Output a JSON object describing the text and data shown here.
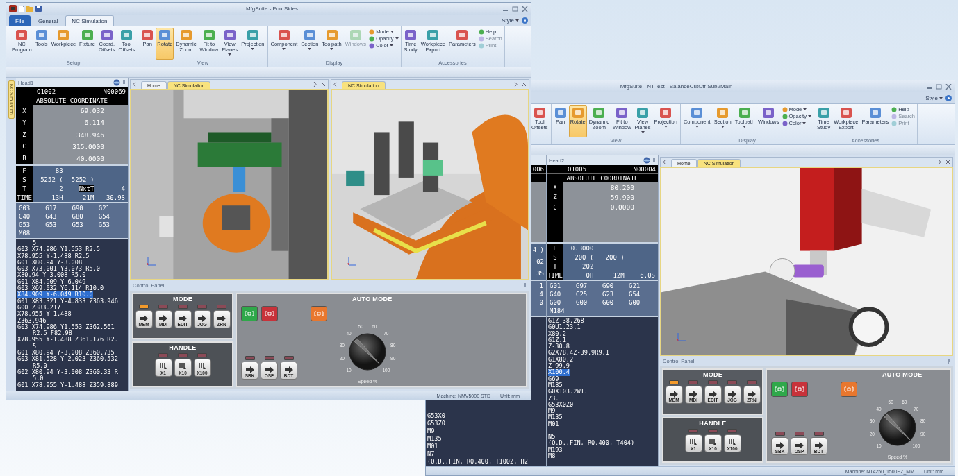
{
  "windows": [
    {
      "title": "MfgSuite - FourSides",
      "tabs": [
        {
          "label": "File",
          "kind": "app",
          "selected": false
        },
        {
          "label": "General",
          "kind": "tab",
          "selected": false
        },
        {
          "label": "NC Simulation",
          "kind": "tab",
          "selected": true
        }
      ],
      "style_menu": "Style",
      "ribbon": [
        {
          "label": "Setup",
          "buttons": [
            {
              "label": "NC\nProgram",
              "selected": false,
              "disabled": false,
              "dropdown": false
            },
            {
              "label": "Tools",
              "selected": false,
              "disabled": false,
              "dropdown": false
            },
            {
              "label": "Workpiece",
              "selected": false,
              "disabled": false,
              "dropdown": false
            },
            {
              "label": "Fixture",
              "selected": false,
              "disabled": false,
              "dropdown": false
            },
            {
              "label": "Coord.\nOffsets",
              "selected": false,
              "disabled": false,
              "dropdown": false
            },
            {
              "label": "Tool\nOffsets",
              "selected": false,
              "disabled": false,
              "dropdown": false
            }
          ]
        },
        {
          "label": "View",
          "buttons": [
            {
              "label": "Pan",
              "selected": false,
              "disabled": false,
              "dropdown": false
            },
            {
              "label": "Rotate",
              "selected": true,
              "disabled": false,
              "dropdown": false
            },
            {
              "label": "Dynamic\nZoom",
              "selected": false,
              "disabled": false,
              "dropdown": false
            },
            {
              "label": "Fit to\nWindow",
              "selected": false,
              "disabled": false,
              "dropdown": false
            },
            {
              "label": "View\nPlanes",
              "selected": false,
              "disabled": false,
              "dropdown": true
            },
            {
              "label": "Projection",
              "selected": false,
              "disabled": false,
              "dropdown": true
            }
          ]
        },
        {
          "label": "Display",
          "buttons": [
            {
              "label": "Component",
              "selected": false,
              "disabled": false,
              "dropdown": true
            },
            {
              "label": "Section",
              "selected": false,
              "disabled": false,
              "dropdown": true
            },
            {
              "label": "Toolpath",
              "selected": false,
              "disabled": false,
              "dropdown": true
            },
            {
              "label": "Windows",
              "selected": false,
              "disabled": true,
              "dropdown": false
            }
          ],
          "small_buttons": [
            {
              "label": "Mode",
              "disabled": false,
              "dropdown": true
            },
            {
              "label": "Opacity",
              "disabled": false,
              "dropdown": true
            },
            {
              "label": "Color",
              "disabled": false,
              "dropdown": true
            }
          ]
        },
        {
          "label": "Accessories",
          "buttons": [
            {
              "label": "Time\nStudy",
              "selected": false,
              "disabled": false,
              "dropdown": false
            },
            {
              "label": "Workpiece\nExport",
              "selected": false,
              "disabled": false,
              "dropdown": false
            },
            {
              "label": "Parameters",
              "selected": false,
              "disabled": false,
              "dropdown": false
            }
          ],
          "small_buttons": [
            {
              "label": "Help",
              "disabled": false,
              "dropdown": false
            },
            {
              "label": "Search",
              "disabled": true,
              "dropdown": false
            },
            {
              "label": "Print",
              "disabled": true,
              "dropdown": false
            }
          ]
        }
      ],
      "side_tab": "NC Simulation",
      "nc_panel": {
        "title": "Head1",
        "program": "O1002",
        "sequence": "N00069",
        "heading": "ABSOLUTE COORDINATE",
        "axes": [
          {
            "label": "X",
            "value": "69.032"
          },
          {
            "label": "Y",
            "value": "6.114"
          },
          {
            "label": "Z",
            "value": "348.946"
          },
          {
            "label": "C",
            "value": "315.0000"
          },
          {
            "label": "B",
            "value": "40.0000"
          }
        ],
        "status_rows": [
          {
            "label": "F",
            "cells": [
              {
                "text": "83",
                "boxed": false
              }
            ]
          },
          {
            "label": "S",
            "cells": [
              {
                "text": "5252 (",
                "boxed": false
              },
              {
                "text": "5252 )",
                "boxed": false
              }
            ]
          },
          {
            "label": "T",
            "cells": [
              {
                "text": "2",
                "boxed": false
              },
              {
                "text": "NxtT",
                "boxed": true
              },
              {
                "text": "4",
                "boxed": false
              }
            ]
          },
          {
            "label": "TIME",
            "cells": [
              {
                "text": "13H",
                "boxed": false
              },
              {
                "text": "21M",
                "boxed": false
              },
              {
                "text": "30.9S",
                "boxed": false
              }
            ]
          }
        ],
        "modal_codes": [
          "G03",
          "G17",
          "G90",
          "G21",
          "G40",
          "G43",
          "G80",
          "G54",
          "G53",
          "G53",
          "G53",
          "G53",
          "M08"
        ],
        "code_lines": [
          {
            "text": "5",
            "continued": true,
            "selected": false
          },
          {
            "text": "G03 X74.986 Y1.553 R2.5",
            "continued": false,
            "selected": false
          },
          {
            "text": "X78.955 Y-1.488 R2.5",
            "continued": false,
            "selected": false
          },
          {
            "text": "G01 X80.94 Y-3.008",
            "continued": false,
            "selected": false
          },
          {
            "text": "G03 X73.001 Y3.073 R5.0",
            "continued": false,
            "selected": false
          },
          {
            "text": "X80.94 Y-3.008 R5.0",
            "continued": false,
            "selected": false
          },
          {
            "text": "G01 X84.909 Y-6.049",
            "continued": false,
            "selected": false
          },
          {
            "text": "G03 X69.032 Y6.114 R10.0",
            "continued": false,
            "selected": false
          },
          {
            "text": "X84.909 Y-6.049 R10.0",
            "continued": false,
            "selected": true
          },
          {
            "text": "G01 X83.321 Y-4.833 Z363.946",
            "continued": false,
            "selected": false
          },
          {
            "text": "G00 Z383.217",
            "continued": false,
            "selected": false
          },
          {
            "text": "X78.955 Y-1.488",
            "continued": false,
            "selected": false
          },
          {
            "text": "Z363.946",
            "continued": false,
            "selected": false
          },
          {
            "text": "G03 X74.986 Y1.553 Z362.561",
            "continued": false,
            "selected": false
          },
          {
            "text": "R2.5 F82.98",
            "continued": true,
            "selected": false
          },
          {
            "text": "X78.955 Y-1.488 Z361.176 R2.",
            "continued": false,
            "selected": false
          },
          {
            "text": "5",
            "continued": true,
            "selected": false
          },
          {
            "text": "G01 X80.94 Y-3.008 Z360.735",
            "continued": false,
            "selected": false
          },
          {
            "text": "G03 X81.528 Y-2.023 Z360.532",
            "continued": false,
            "selected": false
          },
          {
            "text": "R5.0",
            "continued": true,
            "selected": false
          },
          {
            "text": "G02 X80.94 Y-3.008 Z360.33 R",
            "continued": false,
            "selected": false
          },
          {
            "text": "5.0",
            "continued": true,
            "selected": false
          },
          {
            "text": "G01 X78.955 Y-1.488 Z359.889",
            "continued": false,
            "selected": false
          }
        ]
      },
      "panes": [
        {
          "kind": "top_view",
          "tabs": [
            {
              "label": "Home",
              "selected": false
            },
            {
              "label": "NC Simulation",
              "selected": true
            }
          ]
        },
        {
          "kind": "spindle_view",
          "tabs": [
            {
              "label": "NC Simulation",
              "selected": true
            }
          ]
        }
      ],
      "control_panel": {
        "title": "Control Panel",
        "mode": {
          "title": "MODE",
          "buttons": [
            {
              "label": "MEM",
              "lit": true
            },
            {
              "label": "MDI",
              "lit": false
            },
            {
              "label": "EDIT",
              "lit": false
            },
            {
              "label": "JOG",
              "lit": false
            },
            {
              "label": "ZRN",
              "lit": false
            }
          ]
        },
        "handle": {
          "title": "HANDLE",
          "buttons": [
            {
              "label": "X1",
              "lit": false
            },
            {
              "label": "X10",
              "lit": false
            },
            {
              "label": "X100",
              "lit": false
            }
          ]
        },
        "auto": {
          "title": "AUTO MODE",
          "cycle_buttons": [
            {
              "color": "#2fa84a"
            },
            {
              "color": "#c8323a"
            },
            {
              "color": "#e8772e"
            }
          ],
          "buttons": [
            {
              "label": "SBK",
              "lit": false
            },
            {
              "label": "OSP",
              "lit": false
            },
            {
              "label": "BDT",
              "lit": false
            }
          ],
          "dial": {
            "label": "Speed %",
            "ticks": [
              "10",
              "20",
              "30",
              "40",
              "50",
              "60",
              "70",
              "80",
              "90",
              "100"
            ]
          }
        }
      },
      "status": {
        "machine": "Machine: NMV5000 STD",
        "unit": "Unit: mm"
      }
    },
    {
      "title": "MfgSuite - NTTest - BalanceCutOff-Sub2Main",
      "style_menu": "Style",
      "ribbon": [
        {
          "buttons": [
            {
              "label": "Tool\nOffsets",
              "selected": false,
              "disabled": false,
              "dropdown": false
            }
          ]
        },
        {
          "label": "View",
          "buttons": [
            {
              "label": "Pan",
              "selected": false,
              "disabled": false,
              "dropdown": false
            },
            {
              "label": "Rotate",
              "selected": true,
              "disabled": false,
              "dropdown": false
            },
            {
              "label": "Dynamic\nZoom",
              "selected": false,
              "disabled": false,
              "dropdown": false
            },
            {
              "label": "Fit to\nWindow",
              "selected": false,
              "disabled": false,
              "dropdown": false
            },
            {
              "label": "View\nPlanes",
              "selected": false,
              "disabled": false,
              "dropdown": true
            },
            {
              "label": "Projection",
              "selected": false,
              "disabled": false,
              "dropdown": true
            }
          ]
        },
        {
          "label": "Display",
          "buttons": [
            {
              "label": "Component",
              "selected": false,
              "disabled": false,
              "dropdown": true
            },
            {
              "label": "Section",
              "selected": false,
              "disabled": false,
              "dropdown": true
            },
            {
              "label": "Toolpath",
              "selected": false,
              "disabled": false,
              "dropdown": true
            },
            {
              "label": "Windows",
              "selected": false,
              "disabled": false,
              "dropdown": false
            }
          ],
          "small_buttons": [
            {
              "label": "Mode",
              "disabled": false,
              "dropdown": true
            },
            {
              "label": "Opacity",
              "disabled": false,
              "dropdown": true
            },
            {
              "label": "Color",
              "disabled": false,
              "dropdown": true
            }
          ]
        },
        {
          "label": "Accessories",
          "buttons": [
            {
              "label": "Time\nStudy",
              "selected": false,
              "disabled": false,
              "dropdown": false
            },
            {
              "label": "Workpiece\nExport",
              "selected": false,
              "disabled": false,
              "dropdown": false
            },
            {
              "label": "Parameters",
              "selected": false,
              "disabled": false,
              "dropdown": false
            }
          ],
          "small_buttons": [
            {
              "label": "Help",
              "disabled": false,
              "dropdown": false
            },
            {
              "label": "Search",
              "disabled": true,
              "dropdown": false
            },
            {
              "label": "Print",
              "disabled": true,
              "dropdown": false
            }
          ]
        }
      ],
      "partial_panel": {
        "program_tail": "006",
        "status_tails": [
          "4 )",
          "02",
          "3S"
        ],
        "modal_tails": [
          "1",
          "4",
          "0"
        ],
        "code_lines": [
          "G53X0",
          "G53Z0",
          "M9",
          "M135",
          "M01",
          "N7",
          "(O.D.,FIN, R0.400, T1002, H2"
        ]
      },
      "nc_panel": {
        "title": "Head2",
        "program": "O1005",
        "sequence": "N00004",
        "heading": "ABSOLUTE COORDINATE",
        "axes": [
          {
            "label": "X",
            "value": "80.200"
          },
          {
            "label": "Z",
            "value": "-59.900"
          },
          {
            "label": "C",
            "value": "0.0000"
          }
        ],
        "status_rows": [
          {
            "label": "F",
            "cells": [
              {
                "text": "0.3000",
                "boxed": false
              }
            ]
          },
          {
            "label": "S",
            "cells": [
              {
                "text": "200 (",
                "boxed": false
              },
              {
                "text": "200 )",
                "boxed": false
              }
            ]
          },
          {
            "label": "T",
            "cells": [
              {
                "text": "202",
                "boxed": false
              }
            ]
          },
          {
            "label": "TIME",
            "cells": [
              {
                "text": "0H",
                "boxed": false
              },
              {
                "text": "12M",
                "boxed": false
              },
              {
                "text": "6.0S",
                "boxed": false
              }
            ]
          }
        ],
        "modal_codes": [
          "G01",
          "G97",
          "G90",
          "G21",
          "G40",
          "G25",
          "G23",
          "G54",
          "G00",
          "G00",
          "G00",
          "G00",
          "M184"
        ],
        "code_lines": [
          {
            "text": "G1Z-38.268",
            "continued": false,
            "selected": false
          },
          {
            "text": "G0U1.23.1",
            "continued": false,
            "selected": false
          },
          {
            "text": "X80.2",
            "continued": false,
            "selected": false
          },
          {
            "text": "G1Z.1",
            "continued": false,
            "selected": false
          },
          {
            "text": "Z-30.8",
            "continued": false,
            "selected": false
          },
          {
            "text": "G2X78.4Z-39.9R9.1",
            "continued": false,
            "selected": false
          },
          {
            "text": "G1X80.2",
            "continued": false,
            "selected": false
          },
          {
            "text": "Z-99.9",
            "continued": false,
            "selected": false
          },
          {
            "text": "X100.4",
            "continued": false,
            "selected": true
          },
          {
            "text": "G69",
            "continued": false,
            "selected": false
          },
          {
            "text": "M185",
            "continued": false,
            "selected": false
          },
          {
            "text": "G0X103.2W1.",
            "continued": false,
            "selected": false
          },
          {
            "text": "Z3.",
            "continued": false,
            "selected": false
          },
          {
            "text": "G53X0Z0",
            "continued": false,
            "selected": false
          },
          {
            "text": "M9",
            "continued": false,
            "selected": false
          },
          {
            "text": "M135",
            "continued": false,
            "selected": false
          },
          {
            "text": "M01",
            "continued": false,
            "selected": false
          },
          {
            "text": "N5",
            "continued": false,
            "selected": false,
            "blank_before": true
          },
          {
            "text": "(O.D.,FIN, R0.400, T404)",
            "continued": false,
            "selected": false
          },
          {
            "text": "M193",
            "continued": false,
            "selected": false
          },
          {
            "text": "M8",
            "continued": false,
            "selected": false
          }
        ]
      },
      "panes": [
        {
          "kind": "turret_view",
          "tabs": [
            {
              "label": "Home",
              "selected": false
            },
            {
              "label": "NC Simulation",
              "selected": true
            }
          ]
        }
      ],
      "control_panel": {
        "title": "Control Panel",
        "mode": {
          "title": "MODE",
          "buttons": [
            {
              "label": "MEM",
              "lit": true
            },
            {
              "label": "MDI",
              "lit": false
            },
            {
              "label": "EDIT",
              "lit": false
            },
            {
              "label": "JOG",
              "lit": false
            },
            {
              "label": "ZRN",
              "lit": false
            }
          ]
        },
        "handle": {
          "title": "HANDLE",
          "buttons": [
            {
              "label": "X1",
              "lit": false
            },
            {
              "label": "X10",
              "lit": false
            },
            {
              "label": "X100",
              "lit": false
            }
          ]
        },
        "auto": {
          "title": "AUTO MODE",
          "cycle_buttons": [
            {
              "color": "#2fa84a"
            },
            {
              "color": "#c8323a"
            },
            {
              "color": "#e8772e"
            }
          ],
          "buttons": [
            {
              "label": "SBK",
              "lit": false
            },
            {
              "label": "OSP",
              "lit": false
            },
            {
              "label": "BDT",
              "lit": false
            }
          ],
          "dial": {
            "label": "Speed %",
            "ticks": [
              "10",
              "20",
              "30",
              "40",
              "50",
              "60",
              "70",
              "80",
              "90",
              "100"
            ]
          }
        }
      },
      "status": {
        "machine": "Machine: NT4250_1500SZ_MM",
        "unit": "Unit: mm"
      }
    }
  ]
}
